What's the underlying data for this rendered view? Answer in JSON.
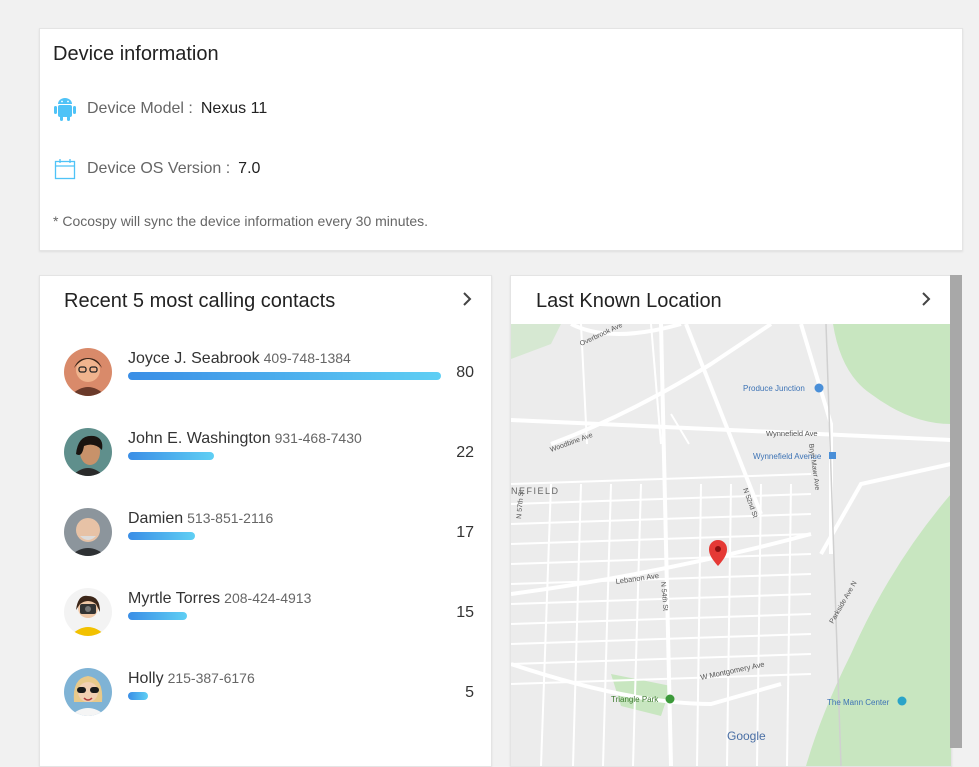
{
  "device_info": {
    "title": "Device information",
    "model_label": "Device Model :",
    "model_value": "Nexus 11",
    "os_label": "Device OS Version :",
    "os_value": "7.0",
    "note": "* Cocospy will sync the device information every 30 minutes."
  },
  "contacts": {
    "title": "Recent 5 most calling contacts",
    "items": [
      {
        "name": "Joyce J. Seabrook",
        "phone": "409-748-1384",
        "count": "80",
        "level": 1.0
      },
      {
        "name": "John E. Washington",
        "phone": "931-468-7430",
        "count": "22",
        "level": 0.275
      },
      {
        "name": "Damien",
        "phone": "513-851-2116",
        "count": "17",
        "level": 0.2125
      },
      {
        "name": "Myrtle Torres",
        "phone": "208-424-4913",
        "count": "15",
        "level": 0.1875
      },
      {
        "name": "Holly",
        "phone": "215-387-6176",
        "count": "5",
        "level": 0.0625
      }
    ]
  },
  "location": {
    "title": "Last Known Location",
    "map_labels": {
      "produce": "Produce Junction",
      "wynnefield_ave": "Wynnefield Avenue",
      "wynnefield_ave_road": "Wynnefield Ave",
      "woodbine": "Woodbine Ave",
      "overbrook": "Overbrook Ave",
      "lebanon": "Lebanon Ave",
      "montgomery": "W Montgomery Ave",
      "parkside": "Parkside Ave N",
      "triangle": "Triangle Park",
      "mann": "The Mann Center",
      "nefield": "NEFIELD",
      "n52": "N 52nd St",
      "n54": "N 54th St",
      "n57": "N 57th St",
      "brynmawr": "Bryn Mawr Ave",
      "google": "Google"
    }
  },
  "colors": {
    "bar_start": "#3a8ee6",
    "bar_end": "#5fcff4",
    "icon_blue": "#4fc3f7",
    "park_green": "#c8e6c0",
    "pin_red": "#e53935"
  }
}
